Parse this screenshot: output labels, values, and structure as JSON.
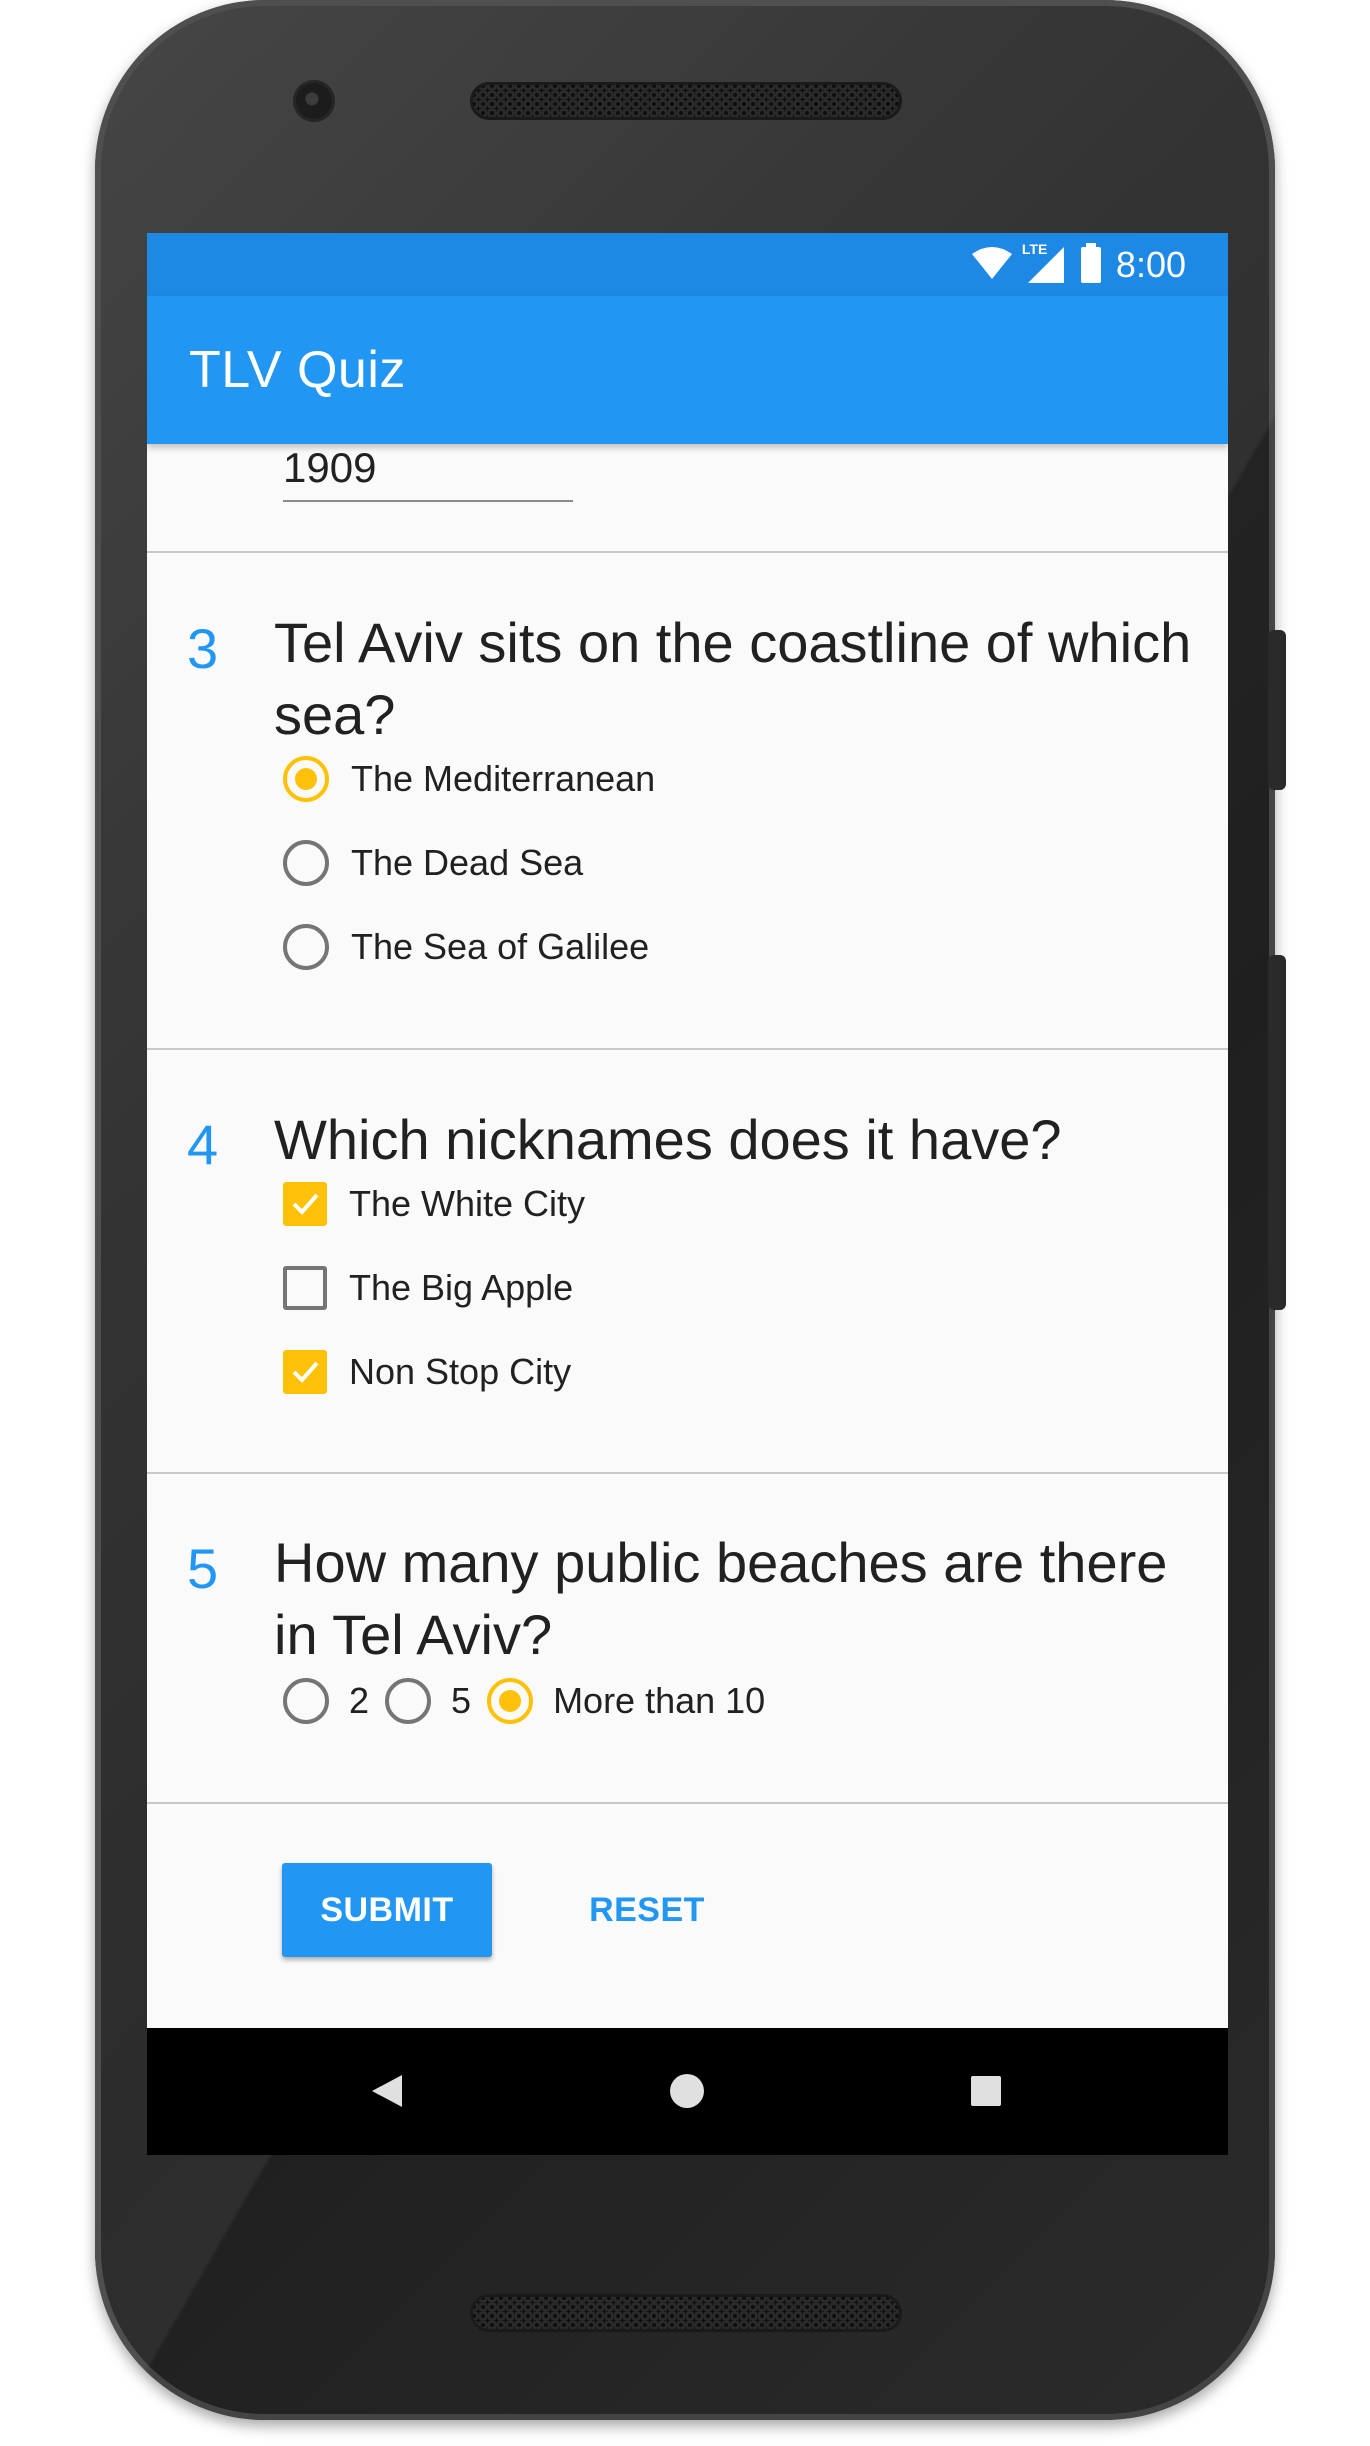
{
  "status_bar": {
    "time": "8:00",
    "icons": [
      "wifi-icon",
      "lte-signal-icon",
      "battery-icon"
    ],
    "network_label": "LTE"
  },
  "app_bar": {
    "title": "TLV Quiz"
  },
  "question_2": {
    "answer_value": "1909"
  },
  "questions": [
    {
      "number": "3",
      "text": "Tel Aviv sits on the coastline of which sea?",
      "type": "radio",
      "options": [
        {
          "label": "The Mediterranean",
          "selected": true
        },
        {
          "label": "The Dead Sea",
          "selected": false
        },
        {
          "label": "The Sea of Galilee",
          "selected": false
        }
      ]
    },
    {
      "number": "4",
      "text": "Which nicknames does it have?",
      "type": "checkbox",
      "options": [
        {
          "label": "The White City",
          "checked": true
        },
        {
          "label": "The Big Apple",
          "checked": false
        },
        {
          "label": "Non Stop City",
          "checked": true
        }
      ]
    },
    {
      "number": "5",
      "text": "How many public beaches are there in Tel Aviv?",
      "type": "radio-inline",
      "options": [
        {
          "label": "2",
          "selected": false
        },
        {
          "label": "5",
          "selected": false
        },
        {
          "label": "More than 10",
          "selected": true
        }
      ]
    }
  ],
  "actions": {
    "submit_label": "SUBMIT",
    "reset_label": "RESET"
  },
  "nav_bar": {
    "buttons": [
      "back-icon",
      "home-icon",
      "recents-icon"
    ]
  },
  "colors": {
    "primary": "#2196f3",
    "primary_dark": "#1e88e5",
    "accent": "#ffc107",
    "text": "#212121",
    "background": "#fafafa"
  }
}
